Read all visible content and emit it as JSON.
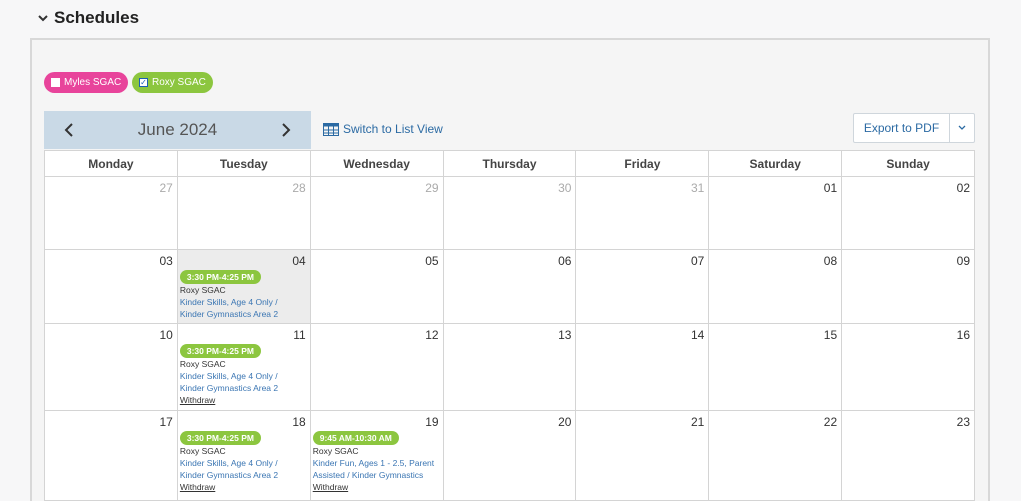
{
  "section": {
    "title": "Schedules"
  },
  "filters": [
    {
      "label": "Myles SGAC",
      "checked": false,
      "color": "#e8449b"
    },
    {
      "label": "Roxy SGAC",
      "checked": true,
      "color": "#8cc63f"
    }
  ],
  "calendar": {
    "month_label": "June 2024",
    "prev_icon": "chevron-left-icon",
    "next_icon": "chevron-right-icon",
    "list_view_label": "Switch to List View",
    "export_label": "Export to PDF",
    "weekdays": [
      "Monday",
      "Tuesday",
      "Wednesday",
      "Thursday",
      "Friday",
      "Saturday",
      "Sunday"
    ],
    "weeks": [
      {
        "days": [
          {
            "num": "27",
            "muted": true
          },
          {
            "num": "28",
            "muted": true
          },
          {
            "num": "29",
            "muted": true
          },
          {
            "num": "30",
            "muted": true
          },
          {
            "num": "31",
            "muted": true
          },
          {
            "num": "01"
          },
          {
            "num": "02"
          }
        ]
      },
      {
        "days": [
          {
            "num": "03"
          },
          {
            "num": "04",
            "today": true,
            "event": {
              "time": "3:30 PM-4:25 PM",
              "org": "Roxy SGAC",
              "class1": "Kinder Skills, Age 4 Only /",
              "class2": "Kinder Gymnastics Area 2"
            }
          },
          {
            "num": "05"
          },
          {
            "num": "06"
          },
          {
            "num": "07"
          },
          {
            "num": "08"
          },
          {
            "num": "09"
          }
        ]
      },
      {
        "days": [
          {
            "num": "10"
          },
          {
            "num": "11",
            "event": {
              "time": "3:30 PM-4:25 PM",
              "org": "Roxy SGAC",
              "class1": "Kinder Skills, Age 4 Only /",
              "class2": "Kinder Gymnastics Area 2",
              "withdraw": "Withdraw"
            }
          },
          {
            "num": "12"
          },
          {
            "num": "13"
          },
          {
            "num": "14"
          },
          {
            "num": "15"
          },
          {
            "num": "16"
          }
        ]
      },
      {
        "days": [
          {
            "num": "17"
          },
          {
            "num": "18",
            "event": {
              "time": "3:30 PM-4:25 PM",
              "org": "Roxy SGAC",
              "class1": "Kinder Skills, Age 4 Only /",
              "class2": "Kinder Gymnastics Area 2",
              "withdraw": "Withdraw"
            }
          },
          {
            "num": "19",
            "event": {
              "time": "9:45 AM-10:30 AM",
              "org": "Roxy SGAC",
              "class1": "Kinder Fun, Ages 1 - 2.5, Parent",
              "class2": "Assisted / Kinder Gymnastics",
              "withdraw": "Withdraw"
            }
          },
          {
            "num": "20"
          },
          {
            "num": "21"
          },
          {
            "num": "22"
          },
          {
            "num": "23"
          }
        ]
      }
    ]
  }
}
